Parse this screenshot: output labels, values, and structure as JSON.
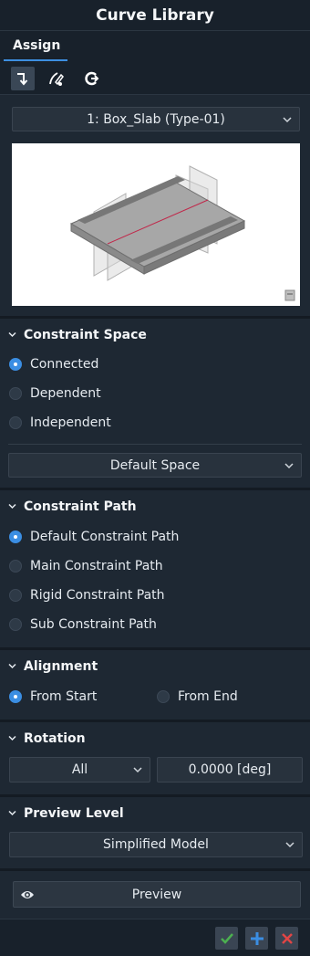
{
  "window": {
    "title": "Curve Library"
  },
  "tabs": [
    {
      "label": "Assign"
    }
  ],
  "toolbar": {
    "buttons": [
      {
        "icon": "curve-arrow-icon",
        "active": true
      },
      {
        "icon": "pen-curve-icon",
        "active": false
      },
      {
        "icon": "cycle-icon",
        "active": false
      }
    ]
  },
  "model_select": {
    "value": "1: Box_Slab (Type-01)"
  },
  "constraint_space": {
    "title": "Constraint Space",
    "options": [
      "Connected",
      "Dependent",
      "Independent"
    ],
    "selected": "Connected",
    "space_select": "Default Space"
  },
  "constraint_path": {
    "title": "Constraint Path",
    "options": [
      "Default Constraint Path",
      "Main Constraint Path",
      "Rigid Constraint Path",
      "Sub Constraint Path"
    ],
    "selected": "Default Constraint Path"
  },
  "alignment": {
    "title": "Alignment",
    "options": [
      "From Start",
      "From End"
    ],
    "selected": "From Start"
  },
  "rotation": {
    "title": "Rotation",
    "axis_select": "All",
    "angle": "0.0000 [deg]"
  },
  "preview_level": {
    "title": "Preview Level",
    "select": "Simplified Model"
  },
  "preview_button": {
    "label": "Preview"
  },
  "colors": {
    "accent": "#3b8ee3",
    "confirm": "#4caf50",
    "add": "#3b8ee3",
    "cancel": "#e04545"
  }
}
